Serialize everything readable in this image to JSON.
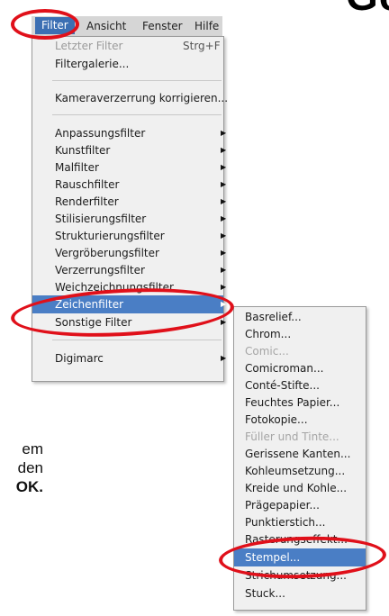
{
  "page": {
    "title_fragment": "Ge",
    "text_lines": [
      "em",
      "den",
      "OK."
    ]
  },
  "menubar": {
    "items": [
      "Filter",
      "Ansicht",
      "Fenster",
      "Hilfe"
    ]
  },
  "filter_menu": {
    "last_filter": "Letzter Filter",
    "last_filter_shortcut": "Strg+F",
    "filter_gallery": "Filtergalerie...",
    "lens_correction": "Kameraverzerrung korrigieren...",
    "submenus": [
      "Anpassungsfilter",
      "Kunstfilter",
      "Malfilter",
      "Rauschfilter",
      "Renderfilter",
      "Stilisierungsfilter",
      "Strukturierungsfilter",
      "Vergröberungsfilter",
      "Verzerrungsfilter",
      "Weichzeichnungsfilter",
      "Zeichenfilter",
      "Sonstige Filter"
    ],
    "highlighted": "Zeichenfilter",
    "digimarc": "Digimarc"
  },
  "zeichenfilter_submenu": {
    "items": [
      {
        "label": "Basrelief...",
        "enabled": true
      },
      {
        "label": "Chrom...",
        "enabled": true
      },
      {
        "label": "Comic...",
        "enabled": false
      },
      {
        "label": "Comicroman...",
        "enabled": true
      },
      {
        "label": "Conté-Stifte...",
        "enabled": true
      },
      {
        "label": "Feuchtes Papier...",
        "enabled": true
      },
      {
        "label": "Fotokopie...",
        "enabled": true
      },
      {
        "label": "Füller und Tinte...",
        "enabled": false
      },
      {
        "label": "Gerissene Kanten...",
        "enabled": true
      },
      {
        "label": "Kohleumsetzung...",
        "enabled": true
      },
      {
        "label": "Kreide und Kohle...",
        "enabled": true
      },
      {
        "label": "Prägepapier...",
        "enabled": true
      },
      {
        "label": "Punktierstich...",
        "enabled": true
      },
      {
        "label": "Rasterungseffekt...",
        "enabled": true
      },
      {
        "label": "Stempel...",
        "enabled": true
      },
      {
        "label": "Strichumsetzung...",
        "enabled": true
      },
      {
        "label": "Stuck...",
        "enabled": true
      }
    ],
    "highlighted": "Stempel..."
  },
  "colors": {
    "highlight": "#4a7ec5",
    "annotation_red": "#e0101a"
  }
}
